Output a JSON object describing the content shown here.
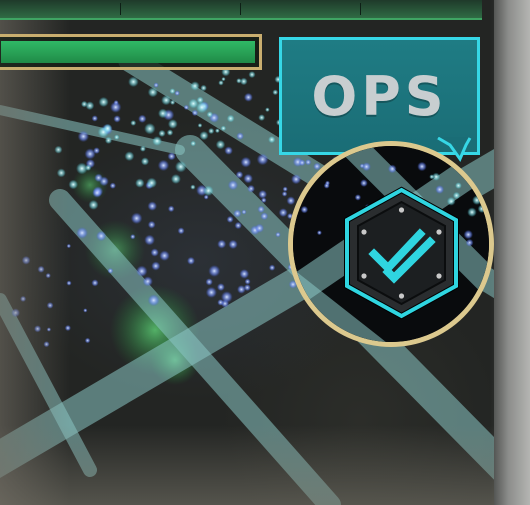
{
  "hud": {
    "ops_label": "OPS",
    "xm_bar_level": 1.0,
    "level_bar_segments": 4
  },
  "colors": {
    "xm_green": "#2fb866",
    "frame_gold": "#c9ae6f",
    "ops_teal": "#1f7c84",
    "ops_border": "#36d7e6",
    "ring_gold": "#dcc98e",
    "badge_cyan": "#2fd5e0"
  },
  "icons": {
    "agent_badge": "hexagon-double-check-icon"
  }
}
